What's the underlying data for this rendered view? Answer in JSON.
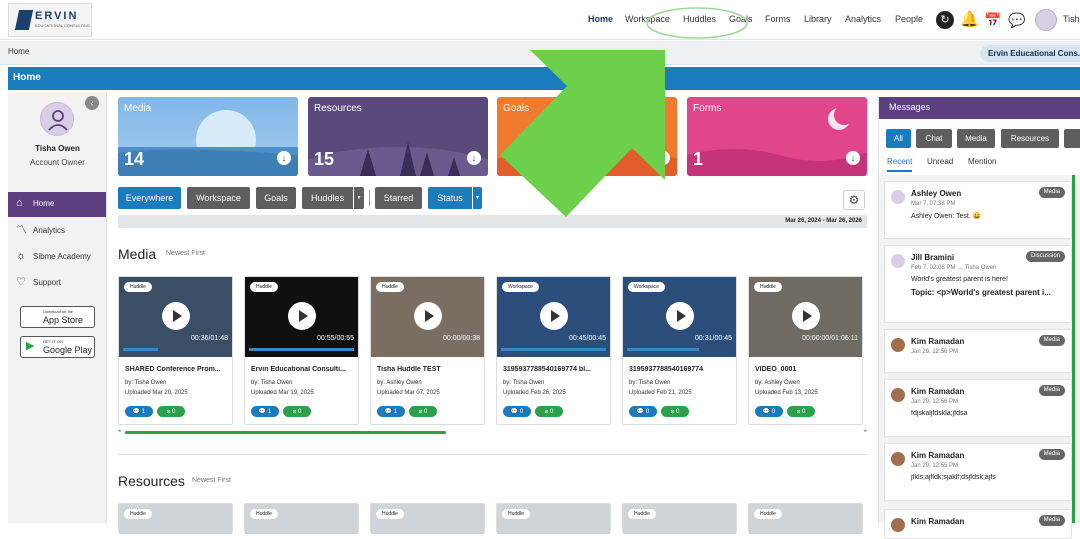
{
  "topnav": {
    "logo_text": "ERVIN",
    "logo_subtext": "EDUCATIONAL CONSULTING",
    "links": [
      "Home",
      "Workspace",
      "Huddles",
      "Goals",
      "Forms",
      "Library",
      "Analytics",
      "People"
    ],
    "active_link": "Home",
    "user_name_truncated": "Tish",
    "colors": {
      "active_link": "#1d3f6e",
      "highlight_ellipse": "#9fd69a"
    }
  },
  "breadcrumb": {
    "label": "Home",
    "org_pill": "Ervin Educational Cons..."
  },
  "home_header": {
    "title": "Home",
    "color": "#1a7bbd"
  },
  "sidebar": {
    "user_name": "Tisha Owen",
    "user_role": "Account Owner",
    "items": [
      {
        "label": "Home",
        "icon": "home-icon",
        "active": true
      },
      {
        "label": "Analytics",
        "icon": "analytics-icon",
        "active": false
      },
      {
        "label": "Sibme Academy",
        "icon": "academy-icon",
        "active": false
      },
      {
        "label": "Support",
        "icon": "heart-icon",
        "active": false
      }
    ],
    "app_store": {
      "small": "Download on the",
      "big": "App Store"
    },
    "google_play": {
      "small": "GET IT ON",
      "big": "Google Play"
    },
    "active_color": "#5d3f7f"
  },
  "tiles": [
    {
      "title": "Media",
      "count": "14",
      "color": "#7fb7e8"
    },
    {
      "title": "Resources",
      "count": "15",
      "color": "#5a4a7c"
    },
    {
      "title": "Goals",
      "count": "",
      "color": "#f07a2e"
    },
    {
      "title": "Forms",
      "count": "1",
      "color": "#e2468a"
    }
  ],
  "filters": {
    "everywhere": "Everywhere",
    "workspace": "Workspace",
    "goals": "Goals",
    "huddles": "Huddles",
    "starred": "Starred",
    "status": "Status",
    "date_range": "Mar 26, 2024 - Mar 26, 2026"
  },
  "media_section": {
    "title": "Media",
    "sort": "Newest First",
    "cards": [
      {
        "badge": "Huddle",
        "duration": "00:36/01:48",
        "progress": 0.33,
        "title": "SHARED Conference Prom...",
        "by": "by: Tisha Owen",
        "uploaded": "Uploaded Mar 20, 2025",
        "comments": "1",
        "attachments": "0"
      },
      {
        "badge": "Huddle",
        "duration": "00:55/00:55",
        "progress": 1.0,
        "title": "Ervin Educational Consulti...",
        "by": "by: Tisha Owen",
        "uploaded": "Uploaded Mar 19, 2025",
        "comments": "1",
        "attachments": "0"
      },
      {
        "badge": "Huddle",
        "duration": "00:00/00:38",
        "progress": 0.0,
        "title": "Tisha Huddle TEST",
        "by": "by: Ashley Owen",
        "uploaded": "Uploaded Mar 07, 2025",
        "comments": "1",
        "attachments": "0"
      },
      {
        "badge": "Workspace",
        "duration": "00:45/00:45",
        "progress": 1.0,
        "title": "3195937788540169774 bl...",
        "by": "by: Tisha Owen",
        "uploaded": "Uploaded Feb 26, 2025",
        "comments": "0",
        "attachments": "0"
      },
      {
        "badge": "Workspace",
        "duration": "00:31/00:45",
        "progress": 0.69,
        "title": "3195937788540169774",
        "by": "by: Tisha Owen",
        "uploaded": "Uploaded Feb 21, 2025",
        "comments": "0",
        "attachments": "0"
      },
      {
        "badge": "Huddle",
        "duration": "00:00:00/01:06:11",
        "progress": 0.0,
        "title": "VIDEO_0001",
        "by": "by: Ashley Owen",
        "uploaded": "Uploaded Feb 13, 2025",
        "comments": "0",
        "attachments": "0"
      }
    ]
  },
  "resources_section": {
    "title": "Resources",
    "sort": "Newest First",
    "badges": [
      "Huddle",
      "Huddle",
      "Huddle",
      "Huddle",
      "Huddle",
      "Huddle"
    ]
  },
  "messages": {
    "title": "Messages",
    "tabs": [
      "All",
      "Chat",
      "Media",
      "Resources"
    ],
    "subtabs": [
      "Recent",
      "Unread",
      "Mention"
    ],
    "items": [
      {
        "name": "Ashley Owen",
        "type": "Media",
        "time": "Mar 7, 07:38 PM",
        "body": "Ashley Owen: Test. 😀",
        "body2": ""
      },
      {
        "name": "Jill Bramini",
        "type": "Discussion",
        "time": "Feb 7, 02:08 PM → Tisha Owen",
        "body": "World's greatest parent is here!",
        "body2": "Topic: <p>World's greatest parent i..."
      },
      {
        "name": "Kim Ramadan",
        "type": "Media",
        "time": "Jan 29, 12:56 PM",
        "body": "",
        "body2": ""
      },
      {
        "name": "Kim Ramadan",
        "type": "Media",
        "time": "Jan 29, 12:56 PM",
        "body": "fdjskaljfdskla;jfdsa",
        "body2": ""
      },
      {
        "name": "Kim Ramadan",
        "type": "Media",
        "time": "Jan 29, 12:55 PM",
        "body": "jfkls;ajfldk;sjaklf;dsjfdsk;ajfs",
        "body2": ""
      },
      {
        "name": "Kim Ramadan",
        "type": "Media",
        "time": "",
        "body": "",
        "body2": ""
      }
    ]
  },
  "annotation": {
    "arrow_color": "#6cd04a"
  }
}
